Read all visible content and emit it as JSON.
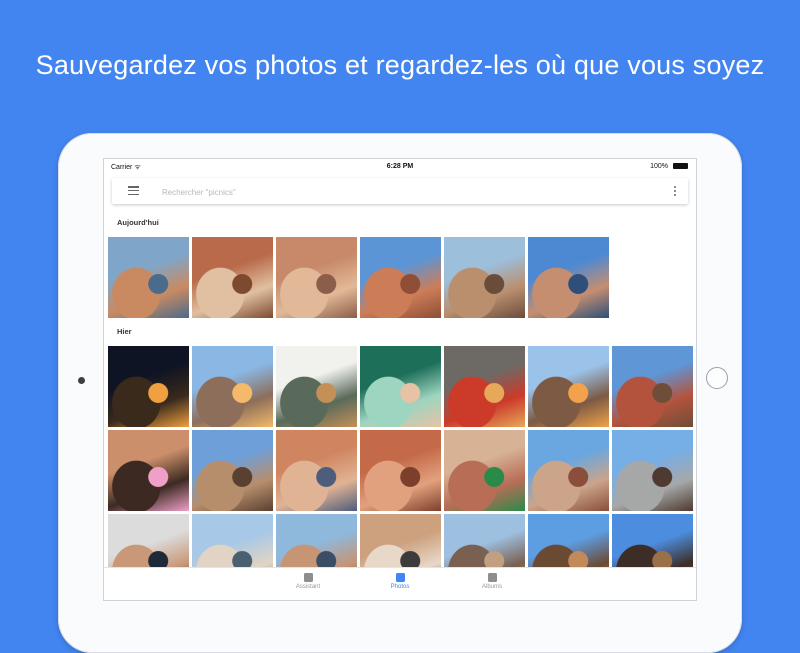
{
  "headline": "Sauvegardez vos photos et regardez-les où que vous soyez",
  "status": {
    "carrier": "Carrier ᯤ",
    "time": "6:28 PM",
    "battery": "100%"
  },
  "search": {
    "placeholder": "Rechercher \"picnics\"",
    "menu_icon": "menu-icon",
    "more_icon": "more-vert-icon"
  },
  "sections": [
    {
      "label": "Aujourd'hui"
    },
    {
      "label": "Hier"
    }
  ],
  "photos": [
    {
      "id": "today-1",
      "description": "family-selfie",
      "colors": [
        "#7fa6c9",
        "#c98a62",
        "#4a6b8a"
      ]
    },
    {
      "id": "today-2",
      "description": "kids-on-rocks",
      "colors": [
        "#b86a4a",
        "#e0c0a0",
        "#7d4a30"
      ]
    },
    {
      "id": "today-3",
      "description": "canyon-hike",
      "colors": [
        "#c7896a",
        "#e2b998",
        "#8a5e48"
      ]
    },
    {
      "id": "today-4",
      "description": "rock-climbing",
      "colors": [
        "#5b95d6",
        "#cc7d58",
        "#8f4e35"
      ]
    },
    {
      "id": "today-5",
      "description": "girl-in-desert",
      "colors": [
        "#9cbfdc",
        "#b98f6e",
        "#6a4c3a"
      ]
    },
    {
      "id": "today-6",
      "description": "father-child-selfie",
      "colors": [
        "#4d89d2",
        "#c58e70",
        "#2d4f7a"
      ]
    },
    {
      "id": "yest-1",
      "description": "campfire-night",
      "colors": [
        "#0e1424",
        "#3a2a1c",
        "#f0a040"
      ]
    },
    {
      "id": "yest-2",
      "description": "campsite-fire",
      "colors": [
        "#8ab7e3",
        "#8d6e5a",
        "#f4b96a"
      ]
    },
    {
      "id": "yest-3",
      "description": "food-bowls",
      "colors": [
        "#f1f1ee",
        "#5a6a5a",
        "#c59058"
      ]
    },
    {
      "id": "yest-4",
      "description": "tent-selfie",
      "colors": [
        "#1e6f5a",
        "#9ed5c0",
        "#e7c2a4"
      ]
    },
    {
      "id": "yest-5",
      "description": "campfire-pot",
      "colors": [
        "#6d6a66",
        "#cc3a2a",
        "#e7a85a"
      ]
    },
    {
      "id": "yest-6",
      "description": "campsite-evening",
      "colors": [
        "#9bc2e8",
        "#7c5a44",
        "#f2a24a"
      ]
    },
    {
      "id": "yest-7",
      "description": "boy-on-rocks",
      "colors": [
        "#5e96d6",
        "#b4533d",
        "#6e4e38"
      ]
    },
    {
      "id": "yest-8",
      "description": "boy-portrait",
      "colors": [
        "#cc8f6b",
        "#3c2a22",
        "#f0a0c8"
      ]
    },
    {
      "id": "yest-9",
      "description": "desert-walk",
      "colors": [
        "#6f9fd8",
        "#b78e6c",
        "#5a4030"
      ]
    },
    {
      "id": "yest-10",
      "description": "rock-formation-group",
      "colors": [
        "#cf8660",
        "#e0b394",
        "#4d5d7c"
      ]
    },
    {
      "id": "yest-11",
      "description": "rock-hole-face",
      "colors": [
        "#c46a48",
        "#e2a17e",
        "#7c3f2c"
      ]
    },
    {
      "id": "yest-12",
      "description": "woman-rocks",
      "colors": [
        "#d7b295",
        "#b86d56",
        "#2a8a4a"
      ]
    },
    {
      "id": "yest-13",
      "description": "climbing-rock",
      "colors": [
        "#6aa6e0",
        "#cba48a",
        "#8a4e3a"
      ]
    },
    {
      "id": "yest-14",
      "description": "viewing-scope",
      "colors": [
        "#76aee6",
        "#a6a8a8",
        "#4e3a30"
      ]
    },
    {
      "id": "yest-15",
      "description": "couple-selfie",
      "colors": [
        "#dcdcdc",
        "#c89878",
        "#1e2a3a"
      ]
    },
    {
      "id": "yest-16",
      "description": "kids-and-car",
      "colors": [
        "#a7c8e6",
        "#e2d4c4",
        "#4a6070"
      ]
    },
    {
      "id": "yest-17",
      "description": "family-group",
      "colors": [
        "#8fb8dd",
        "#c79474",
        "#3a4e66"
      ]
    },
    {
      "id": "yest-18",
      "description": "cliff-portrait",
      "colors": [
        "#cda07e",
        "#e8d8c8",
        "#3c3c3c"
      ]
    },
    {
      "id": "yest-19",
      "description": "mountain-view",
      "colors": [
        "#9dbfe0",
        "#7a6050",
        "#c0a080"
      ]
    },
    {
      "id": "yest-20",
      "description": "horse-ride",
      "colors": [
        "#5d9de2",
        "#6b4a34",
        "#c28a5a"
      ]
    },
    {
      "id": "yest-21",
      "description": "rider-silhouette",
      "colors": [
        "#4d8ddf",
        "#3c2e26",
        "#9a7048"
      ]
    }
  ],
  "nav": [
    {
      "label": "Assistant",
      "icon": "assistant-icon",
      "active": false
    },
    {
      "label": "Photos",
      "icon": "photos-icon",
      "active": true
    },
    {
      "label": "Albums",
      "icon": "albums-icon",
      "active": false
    }
  ],
  "colors": {
    "background": "#4285f0",
    "accent": "#4285f4",
    "inactive": "#9a9a9a"
  }
}
